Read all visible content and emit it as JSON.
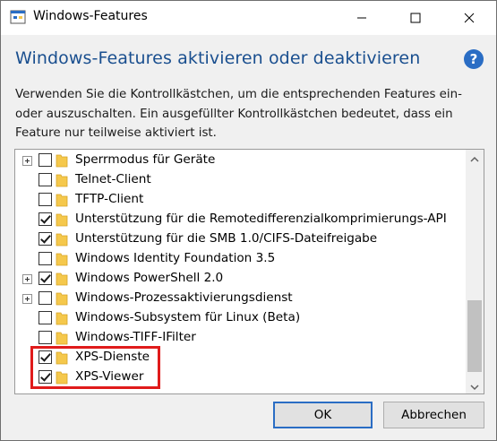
{
  "window": {
    "title": "Windows-Features",
    "heading": "Windows-Features aktivieren oder deaktivieren",
    "description": "Verwenden Sie die Kontrollkästchen, um die entsprechenden Features ein- oder auszuschalten. Ein ausgefüllter Kontrollkästchen bedeutet, dass ein Feature nur teilweise aktiviert ist.",
    "help_label": "?"
  },
  "features": [
    {
      "label": "Sperrmodus für Geräte",
      "checked": false,
      "expandable": true
    },
    {
      "label": "Telnet-Client",
      "checked": false,
      "expandable": false
    },
    {
      "label": "TFTP-Client",
      "checked": false,
      "expandable": false
    },
    {
      "label": "Unterstützung für die Remotedifferenzialkomprimierungs-API",
      "checked": true,
      "expandable": false
    },
    {
      "label": "Unterstützung für die SMB 1.0/CIFS-Dateifreigabe",
      "checked": true,
      "expandable": false
    },
    {
      "label": "Windows Identity Foundation 3.5",
      "checked": false,
      "expandable": false
    },
    {
      "label": "Windows PowerShell 2.0",
      "checked": true,
      "expandable": true
    },
    {
      "label": "Windows-Prozessaktivierungsdienst",
      "checked": false,
      "expandable": true
    },
    {
      "label": "Windows-Subsystem für Linux (Beta)",
      "checked": false,
      "expandable": false
    },
    {
      "label": "Windows-TIFF-IFilter",
      "checked": false,
      "expandable": false
    },
    {
      "label": "XPS-Dienste",
      "checked": true,
      "expandable": false
    },
    {
      "label": "XPS-Viewer",
      "checked": true,
      "expandable": false
    }
  ],
  "buttons": {
    "ok": "OK",
    "cancel": "Abbrechen"
  },
  "colors": {
    "heading": "#1a4f8f",
    "highlight": "#e01b1b",
    "folder": "#f5c84c"
  }
}
